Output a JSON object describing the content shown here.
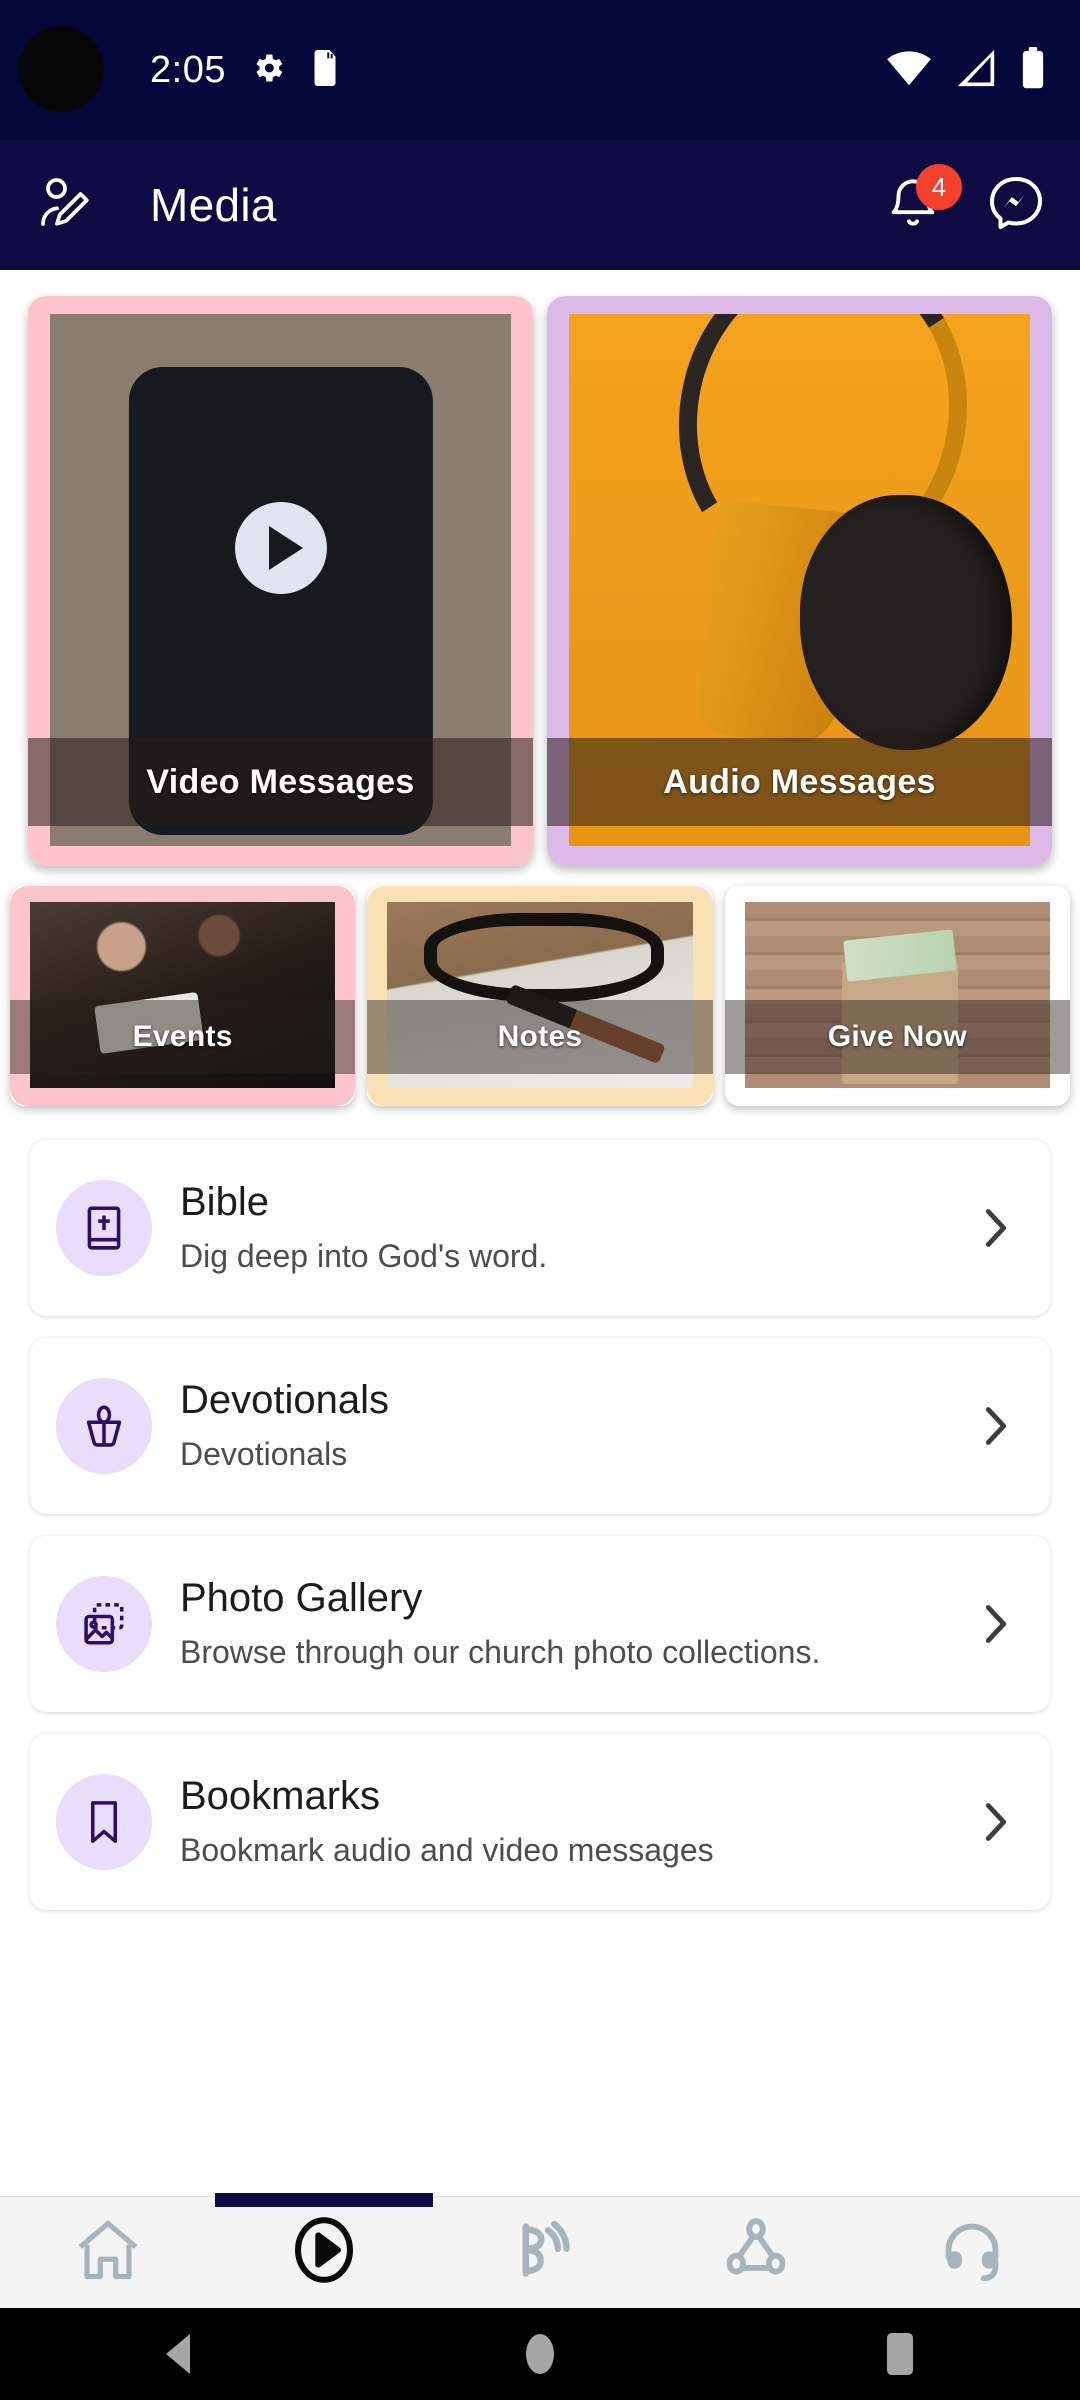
{
  "status_bar": {
    "time": "2:05",
    "icons": [
      "settings-gear-icon",
      "sd-card-icon",
      "wifi-icon",
      "cellular-signal-icon",
      "battery-icon"
    ]
  },
  "app_bar": {
    "title": "Media",
    "profile_icon": "person-edit-icon",
    "notification_icon": "bell-icon",
    "notification_badge": "4",
    "messenger_icon": "messenger-chat-icon"
  },
  "featured_cards": [
    {
      "label": "Video Messages",
      "border_color": "#fbc5cb",
      "image": "phone-video-thumbnail"
    },
    {
      "label": "Audio Messages",
      "border_color": "#ddb9e8",
      "image": "orange-headphones"
    }
  ],
  "quick_cards": [
    {
      "label": "Events",
      "border_color": "#fbc5cb",
      "image": "congregation-seated"
    },
    {
      "label": "Notes",
      "border_color": "#fae0b5",
      "image": "glasses-notebook-pen"
    },
    {
      "label": "Give Now",
      "border_color": "#ffffff",
      "image": "money-in-envelope"
    }
  ],
  "list_items": [
    {
      "title": "Bible",
      "subtitle": "Dig deep into God's word.",
      "icon": "bible-book-icon"
    },
    {
      "title": "Devotionals",
      "subtitle": "Devotionals",
      "icon": "devotional-flame-icon"
    },
    {
      "title": "Photo Gallery",
      "subtitle": "Browse through our church photo collections.",
      "icon": "photo-gallery-icon"
    },
    {
      "title": "Bookmarks",
      "subtitle": "Bookmark audio and video messages",
      "icon": "bookmark-icon"
    }
  ],
  "bottom_nav": [
    {
      "name": "home",
      "icon": "home-icon",
      "active": false
    },
    {
      "name": "media",
      "icon": "play-circle-icon",
      "active": true
    },
    {
      "name": "live",
      "icon": "broadcast-icon",
      "active": false
    },
    {
      "name": "connect",
      "icon": "share-nodes-icon",
      "active": false
    },
    {
      "name": "support",
      "icon": "headset-icon",
      "active": false
    }
  ],
  "android_nav": [
    "back-button",
    "home-button",
    "recents-button"
  ],
  "theme": {
    "header_bg": "#0d0b42",
    "status_bg": "#05063a",
    "accent_badge": "#f5402c",
    "icon_bubble": "#eadcfb",
    "icon_stroke": "#2e0f63",
    "nav_bg": "#f4f4f5",
    "nav_inactive": "#a8b4bd",
    "nav_active": "#0a0a0a"
  }
}
